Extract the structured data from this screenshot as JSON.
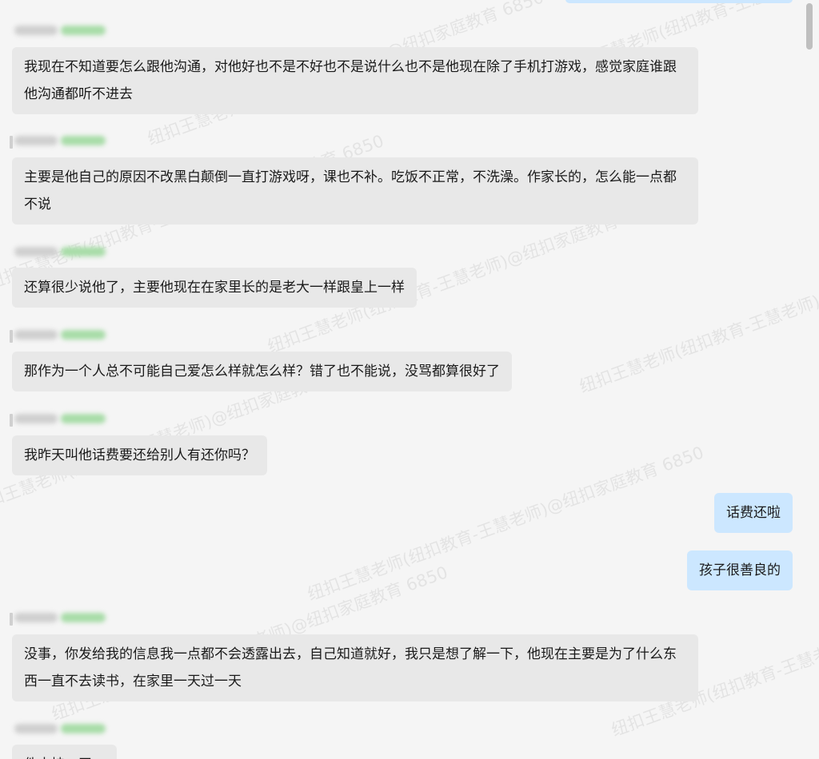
{
  "watermark_text": "纽扣王慧老师(纽扣教育-王慧老师)@纽扣家庭教育 6850",
  "colors": {
    "background": "#f5f5f5",
    "incoming_bubble": "#e8e8e8",
    "outgoing_bubble": "#cce7ff",
    "text": "#1a1a1a"
  },
  "messages": [
    {
      "side": "left",
      "text": "我现在不知道要怎么跟他沟通，对他好也不是不好也不是说什么也不是他现在除了手机打游戏，感觉家庭谁跟他沟通都听不进去"
    },
    {
      "side": "left",
      "text": "主要是他自己的原因不改黑白颠倒一直打游戏呀，课也不补。吃饭不正常，不洗澡。作家长的，怎么能一点都不说"
    },
    {
      "side": "left",
      "text": "还算很少说他了，主要他现在在家里长的是老大一样跟皇上一样"
    },
    {
      "side": "left",
      "text": "那作为一个人总不可能自己爱怎么样就怎么样？错了也不能说，没骂都算很好了"
    },
    {
      "side": "left",
      "text": "我昨天叫他话费要还给别人有还你吗？"
    },
    {
      "side": "right",
      "text": "话费还啦"
    },
    {
      "side": "right",
      "text": "孩子很善良的"
    },
    {
      "side": "left",
      "text": "没事，你发给我的信息我一点都不会透露出去，自己知道就好，我只是想了解一下，他现在主要是为了什么东西一直不去读书，在家里一天过一天"
    },
    {
      "side": "left",
      "text": "件支持一天..."
    }
  ]
}
